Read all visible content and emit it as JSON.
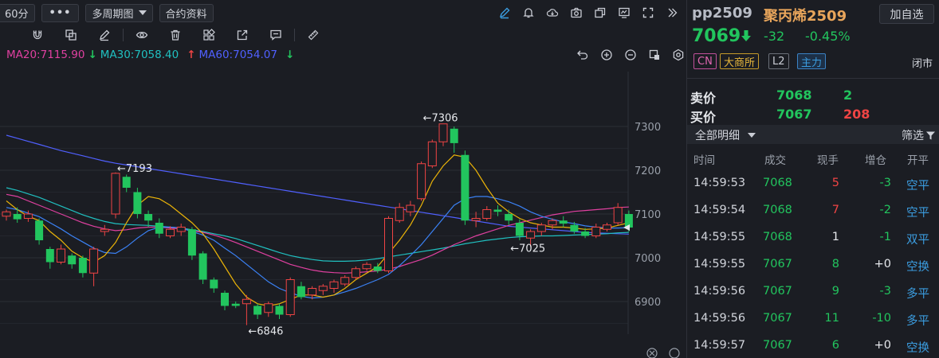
{
  "toolbar": {
    "period": "60分",
    "more": "•••",
    "multi_period": "多周期图",
    "contract_info": "合约资料",
    "icons": [
      "pen-icon",
      "bell-icon",
      "cloud-icon",
      "camera-icon",
      "copy-window-icon",
      "monitor-icon",
      "fullscreen-icon",
      "collapse-panel-icon"
    ]
  },
  "drawtools": {
    "icons": [
      "magnet-icon",
      "layers-icon",
      "eraser-icon",
      "eye-icon",
      "trash-icon",
      "grid-icon",
      "export-icon",
      "comment-icon",
      "ruler-icon"
    ]
  },
  "ma_legend": {
    "ma20": "MA20:7115.90",
    "ma30": "MA30:7058.40",
    "ma60": "MA60:7054.07",
    "ma20_color": "#e040a0",
    "ma30_color": "#20c0c0",
    "ma60_color": "#5060ff"
  },
  "chart_data": {
    "type": "candlestick",
    "y_ticks": [
      "7300",
      "7200",
      "7100",
      "7000",
      "6900"
    ],
    "ylim": [
      6830,
      7360
    ],
    "annotations": [
      {
        "label": "←7193",
        "value": 7193,
        "index": 10
      },
      {
        "label": "←7306",
        "value": 7306,
        "index": 38
      },
      {
        "label": "←6846",
        "value": 6846,
        "index": 22
      },
      {
        "label": "←7025",
        "value": 7025,
        "index": 46
      }
    ],
    "candles": [
      [
        7095,
        7105,
        7085,
        7110
      ],
      [
        7100,
        7088,
        7080,
        7115
      ],
      [
        7090,
        7100,
        7082,
        7108
      ],
      [
        7085,
        7040,
        7030,
        7090
      ],
      [
        7020,
        6990,
        6975,
        7025
      ],
      [
        6990,
        7020,
        6985,
        7030
      ],
      [
        7005,
        6985,
        6975,
        7010
      ],
      [
        7000,
        6965,
        6955,
        7005
      ],
      [
        6965,
        7020,
        6935,
        7025
      ],
      [
        7060,
        7065,
        7050,
        7075
      ],
      [
        7100,
        7193,
        7090,
        7195
      ],
      [
        7185,
        7160,
        7150,
        7190
      ],
      [
        7150,
        7100,
        7090,
        7160
      ],
      [
        7100,
        7085,
        7070,
        7108
      ],
      [
        7080,
        7055,
        7045,
        7090
      ],
      [
        7050,
        7065,
        7045,
        7072
      ],
      [
        7060,
        7070,
        7050,
        7078
      ],
      [
        7065,
        7005,
        6995,
        7070
      ],
      [
        7010,
        6950,
        6940,
        7015
      ],
      [
        6950,
        6930,
        6920,
        6955
      ],
      [
        6920,
        6890,
        6880,
        6925
      ],
      [
        6895,
        6890,
        6885,
        6900
      ],
      [
        6895,
        6905,
        6846,
        6915
      ],
      [
        6890,
        6870,
        6860,
        6895
      ],
      [
        6875,
        6895,
        6865,
        6900
      ],
      [
        6890,
        6870,
        6860,
        6895
      ],
      [
        6870,
        6950,
        6865,
        6955
      ],
      [
        6935,
        6910,
        6905,
        6945
      ],
      [
        6915,
        6930,
        6905,
        6935
      ],
      [
        6925,
        6935,
        6915,
        6940
      ],
      [
        6930,
        6945,
        6920,
        6950
      ],
      [
        6940,
        6955,
        6935,
        6960
      ],
      [
        6955,
        6975,
        6950,
        6980
      ],
      [
        6975,
        6985,
        6970,
        6990
      ],
      [
        6980,
        6970,
        6965,
        6988
      ],
      [
        6970,
        7090,
        6965,
        7095
      ],
      [
        7085,
        7115,
        7080,
        7125
      ],
      [
        7105,
        7120,
        7095,
        7130
      ],
      [
        7135,
        7215,
        7130,
        7220
      ],
      [
        7210,
        7265,
        7205,
        7270
      ],
      [
        7265,
        7306,
        7255,
        7306
      ],
      [
        7295,
        7262,
        7240,
        7300
      ],
      [
        7235,
        7085,
        7075,
        7245
      ],
      [
        7085,
        7090,
        7070,
        7105
      ],
      [
        7090,
        7110,
        7085,
        7118
      ],
      [
        7110,
        7105,
        7095,
        7120
      ],
      [
        7100,
        7085,
        7075,
        7110
      ],
      [
        7080,
        7050,
        7040,
        7088
      ],
      [
        7045,
        7060,
        7025,
        7065
      ],
      [
        7060,
        7075,
        7050,
        7080
      ],
      [
        7075,
        7085,
        7065,
        7090
      ],
      [
        7085,
        7078,
        7070,
        7095
      ],
      [
        7075,
        7060,
        7055,
        7082
      ],
      [
        7060,
        7050,
        7045,
        7068
      ],
      [
        7050,
        7070,
        7045,
        7078
      ],
      [
        7065,
        7075,
        7060,
        7080
      ],
      [
        7080,
        7115,
        7075,
        7125
      ],
      [
        7100,
        7069,
        7060,
        7108
      ]
    ],
    "ma5": [
      7130,
      7110,
      7095,
      7085,
      7060,
      7040,
      7015,
      7000,
      6990,
      7005,
      7035,
      7080,
      7120,
      7140,
      7135,
      7120,
      7100,
      7080,
      7055,
      7020,
      6980,
      6940,
      6910,
      6895,
      6890,
      6895,
      6905,
      6915,
      6915,
      6910,
      6915,
      6930,
      6950,
      6965,
      6980,
      7010,
      7040,
      7075,
      7120,
      7175,
      7210,
      7235,
      7230,
      7200,
      7160,
      7125,
      7105,
      7090,
      7080,
      7075,
      7070,
      7070,
      7068,
      7065,
      7066,
      7068,
      7074,
      7080
    ],
    "ma10": [
      7115,
      7110,
      7102,
      7094,
      7080,
      7066,
      7050,
      7036,
      7022,
      7012,
      7010,
      7025,
      7045,
      7062,
      7070,
      7070,
      7068,
      7060,
      7052,
      7040,
      7022,
      7005,
      6985,
      6965,
      6945,
      6930,
      6920,
      6912,
      6908,
      6910,
      6915,
      6922,
      6930,
      6940,
      6950,
      6962,
      6982,
      7005,
      7030,
      7060,
      7090,
      7120,
      7135,
      7140,
      7140,
      7135,
      7128,
      7118,
      7105,
      7095,
      7088,
      7082,
      7078,
      7073,
      7070,
      7068,
      7068,
      7069
    ],
    "ma20": [
      7145,
      7140,
      7130,
      7120,
      7110,
      7100,
      7090,
      7080,
      7072,
      7066,
      7062,
      7064,
      7068,
      7070,
      7070,
      7068,
      7066,
      7062,
      7058,
      7052,
      7044,
      7035,
      7025,
      7015,
      7005,
      6995,
      6985,
      6978,
      6972,
      6968,
      6966,
      6965,
      6966,
      6968,
      6970,
      6974,
      6980,
      6988,
      6996,
      7006,
      7018,
      7030,
      7040,
      7050,
      7058,
      7066,
      7074,
      7080,
      7086,
      7092,
      7098,
      7102,
      7106,
      7108,
      7110,
      7112,
      7115,
      7116
    ],
    "ma30": [
      7160,
      7154,
      7146,
      7138,
      7128,
      7118,
      7108,
      7098,
      7090,
      7083,
      7078,
      7076,
      7075,
      7074,
      7072,
      7070,
      7068,
      7064,
      7060,
      7055,
      7050,
      7044,
      7036,
      7028,
      7020,
      7012,
      7005,
      7000,
      6996,
      6993,
      6992,
      6992,
      6993,
      6995,
      6998,
      7002,
      7006,
      7010,
      7014,
      7018,
      7022,
      7027,
      7032,
      7036,
      7040,
      7043,
      7046,
      7048,
      7049,
      7050,
      7050,
      7051,
      7052,
      7053,
      7054,
      7055,
      7057,
      7058
    ],
    "ma60": [
      7280,
      7273,
      7266,
      7259,
      7252,
      7245,
      7239,
      7233,
      7227,
      7221,
      7216,
      7212,
      7208,
      7204,
      7200,
      7196,
      7192,
      7188,
      7184,
      7180,
      7176,
      7172,
      7168,
      7164,
      7160,
      7156,
      7152,
      7148,
      7144,
      7140,
      7136,
      7132,
      7128,
      7124,
      7120,
      7116,
      7112,
      7108,
      7104,
      7100,
      7096,
      7092,
      7088,
      7084,
      7080,
      7076,
      7072,
      7070,
      7068,
      7066,
      7064,
      7062,
      7060,
      7058,
      7057,
      7056,
      7055,
      7054
    ]
  },
  "quote": {
    "symbol": "pp2509",
    "name": "聚丙烯2509",
    "add_watch": "加自选",
    "last": "7069",
    "change": "-32",
    "change_pct": "-0.45%",
    "tags": [
      "CN",
      "大商所",
      "L2",
      "主力"
    ],
    "status": "闭市",
    "ask_label": "卖价",
    "ask_price": "7068",
    "ask_vol": "2",
    "bid_label": "买价",
    "bid_price": "7067",
    "bid_vol": "208",
    "filter_label": "全部明细",
    "filter_btn": "筛选"
  },
  "ticks": {
    "headers": [
      "时间",
      "成交",
      "现手",
      "增仓",
      "开平"
    ],
    "rows": [
      {
        "time": "14:59:53",
        "price": "7068",
        "vol": "5",
        "oi": "-3",
        "type": "空平",
        "vol_color": "#ef4444",
        "oi_color": "#22c55e"
      },
      {
        "time": "14:59:54",
        "price": "7068",
        "vol": "7",
        "oi": "-2",
        "type": "空平",
        "vol_color": "#ef4444",
        "oi_color": "#22c55e"
      },
      {
        "time": "14:59:55",
        "price": "7068",
        "vol": "1",
        "oi": "-1",
        "type": "双平",
        "vol_color": "#e6e8ec",
        "oi_color": "#22c55e"
      },
      {
        "time": "14:59:55",
        "price": "7067",
        "vol": "8",
        "oi": "+0",
        "type": "空换",
        "vol_color": "#22c55e",
        "oi_color": "#e6e8ec"
      },
      {
        "time": "14:59:56",
        "price": "7067",
        "vol": "9",
        "oi": "-3",
        "type": "多平",
        "vol_color": "#22c55e",
        "oi_color": "#22c55e"
      },
      {
        "time": "14:59:56",
        "price": "7067",
        "vol": "11",
        "oi": "-10",
        "type": "多平",
        "vol_color": "#22c55e",
        "oi_color": "#22c55e"
      },
      {
        "time": "14:59:57",
        "price": "7067",
        "vol": "6",
        "oi": "+0",
        "type": "空换",
        "vol_color": "#22c55e",
        "oi_color": "#e6e8ec"
      }
    ]
  }
}
